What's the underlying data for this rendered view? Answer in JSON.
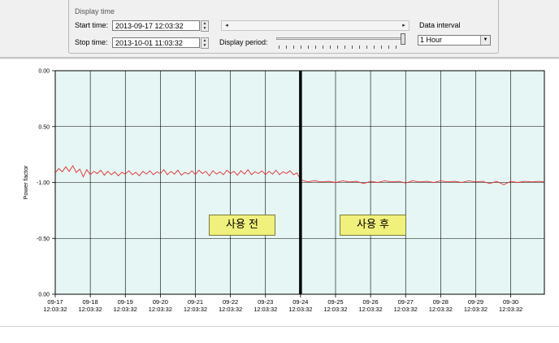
{
  "controls": {
    "group_title": "Display time",
    "start_label": "Start time:",
    "start_value": "2013-09-17  12:03:32",
    "stop_label": "Stop time:",
    "stop_value": "2013-10-01  11:03:32",
    "display_period_label": "Display period:",
    "data_interval_label": "Data interval",
    "data_interval_value": "1 Hour"
  },
  "annotations": {
    "before": "사용 전",
    "after": "사용 후"
  },
  "chart_data": {
    "type": "line",
    "ylabel": "Power factor",
    "y_ticks": [
      "0.00",
      "0.50",
      "-1.00",
      "-0.50",
      "0.00"
    ],
    "x_ticks": [
      {
        "date": "09-17",
        "time": "12:03:32"
      },
      {
        "date": "09-18",
        "time": "12:03:32"
      },
      {
        "date": "09-19",
        "time": "12:03:32"
      },
      {
        "date": "09-20",
        "time": "12:03:32"
      },
      {
        "date": "09-21",
        "time": "12:03:32"
      },
      {
        "date": "09-22",
        "time": "12:03:32"
      },
      {
        "date": "09-23",
        "time": "12:03:32"
      },
      {
        "date": "09-24",
        "time": "12:03:32"
      },
      {
        "date": "09-25",
        "time": "12:03:32"
      },
      {
        "date": "09-26",
        "time": "12:03:32"
      },
      {
        "date": "09-27",
        "time": "12:03:32"
      },
      {
        "date": "09-28",
        "time": "12:03:32"
      },
      {
        "date": "09-29",
        "time": "12:03:32"
      },
      {
        "date": "09-30",
        "time": "12:03:32"
      }
    ],
    "x_range_days": [
      0,
      13.96
    ],
    "y_range_levels": [
      0,
      4
    ],
    "divider_x_day": 7.0,
    "series": [
      {
        "color": "#e03030",
        "points": [
          [
            0.0,
            1.83
          ],
          [
            0.1,
            1.75
          ],
          [
            0.2,
            1.81
          ],
          [
            0.3,
            1.72
          ],
          [
            0.4,
            1.8
          ],
          [
            0.5,
            1.7
          ],
          [
            0.6,
            1.82
          ],
          [
            0.7,
            1.76
          ],
          [
            0.8,
            1.9
          ],
          [
            0.9,
            1.77
          ],
          [
            1.0,
            1.86
          ],
          [
            1.1,
            1.8
          ],
          [
            1.2,
            1.84
          ],
          [
            1.3,
            1.78
          ],
          [
            1.4,
            1.87
          ],
          [
            1.5,
            1.8
          ],
          [
            1.6,
            1.86
          ],
          [
            1.7,
            1.81
          ],
          [
            1.8,
            1.88
          ],
          [
            1.9,
            1.82
          ],
          [
            2.0,
            1.85
          ],
          [
            2.1,
            1.79
          ],
          [
            2.2,
            1.86
          ],
          [
            2.3,
            1.82
          ],
          [
            2.4,
            1.88
          ],
          [
            2.5,
            1.8
          ],
          [
            2.6,
            1.85
          ],
          [
            2.7,
            1.79
          ],
          [
            2.8,
            1.86
          ],
          [
            2.9,
            1.81
          ],
          [
            3.0,
            1.84
          ],
          [
            3.1,
            1.77
          ],
          [
            3.2,
            1.86
          ],
          [
            3.3,
            1.8
          ],
          [
            3.4,
            1.85
          ],
          [
            3.5,
            1.78
          ],
          [
            3.6,
            1.87
          ],
          [
            3.7,
            1.82
          ],
          [
            3.8,
            1.85
          ],
          [
            3.9,
            1.79
          ],
          [
            4.0,
            1.86
          ],
          [
            4.1,
            1.78
          ],
          [
            4.2,
            1.84
          ],
          [
            4.3,
            1.8
          ],
          [
            4.4,
            1.88
          ],
          [
            4.5,
            1.79
          ],
          [
            4.6,
            1.85
          ],
          [
            4.7,
            1.81
          ],
          [
            4.8,
            1.86
          ],
          [
            4.9,
            1.78
          ],
          [
            5.0,
            1.84
          ],
          [
            5.1,
            1.8
          ],
          [
            5.2,
            1.87
          ],
          [
            5.3,
            1.79
          ],
          [
            5.4,
            1.85
          ],
          [
            5.5,
            1.77
          ],
          [
            5.6,
            1.86
          ],
          [
            5.7,
            1.81
          ],
          [
            5.8,
            1.84
          ],
          [
            5.9,
            1.79
          ],
          [
            6.0,
            1.86
          ],
          [
            6.1,
            1.8
          ],
          [
            6.2,
            1.85
          ],
          [
            6.3,
            1.78
          ],
          [
            6.4,
            1.86
          ],
          [
            6.5,
            1.81
          ],
          [
            6.6,
            1.84
          ],
          [
            6.7,
            1.79
          ],
          [
            6.8,
            1.86
          ],
          [
            6.9,
            1.83
          ],
          [
            7.0,
            1.95
          ],
          [
            7.2,
            1.99
          ],
          [
            7.4,
            1.97
          ],
          [
            7.6,
            1.99
          ],
          [
            7.8,
            1.98
          ],
          [
            8.0,
            2.0
          ],
          [
            8.2,
            1.97
          ],
          [
            8.4,
            1.99
          ],
          [
            8.6,
            1.98
          ],
          [
            8.8,
            2.02
          ],
          [
            9.0,
            1.98
          ],
          [
            9.2,
            2.0
          ],
          [
            9.4,
            1.97
          ],
          [
            9.6,
            1.99
          ],
          [
            9.8,
            1.98
          ],
          [
            10.0,
            2.01
          ],
          [
            10.2,
            1.97
          ],
          [
            10.4,
            1.99
          ],
          [
            10.6,
            1.98
          ],
          [
            10.8,
            2.0
          ],
          [
            11.0,
            1.97
          ],
          [
            11.2,
            1.99
          ],
          [
            11.4,
            1.98
          ],
          [
            11.6,
            2.0
          ],
          [
            11.8,
            1.97
          ],
          [
            12.0,
            1.99
          ],
          [
            12.2,
            1.98
          ],
          [
            12.4,
            2.02
          ],
          [
            12.6,
            1.98
          ],
          [
            12.8,
            2.04
          ],
          [
            13.0,
            1.98
          ],
          [
            13.2,
            2.0
          ],
          [
            13.4,
            1.98
          ],
          [
            13.6,
            1.99
          ],
          [
            13.8,
            1.98
          ],
          [
            13.96,
            1.99
          ]
        ]
      }
    ]
  }
}
